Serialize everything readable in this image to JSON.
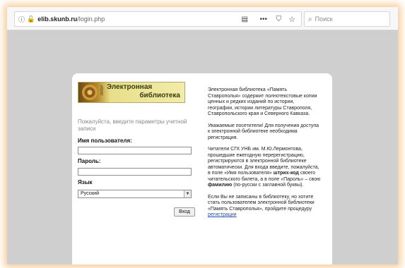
{
  "browser": {
    "url_host": "elib.skunb.ru",
    "url_path": "/login.php",
    "search_placeholder": "Поиск"
  },
  "logo": {
    "line1": "Электронная",
    "line2": "библиотека",
    "small": "ЛИБР"
  },
  "login": {
    "prompt": "Пожалуйста, введите параметры учетной записи",
    "username_label": "Имя пользователя:",
    "password_label": "Пароль:",
    "language_label": "Язык",
    "language_value": "Русский",
    "submit_label": "Вход"
  },
  "info": {
    "p1": "Электронная библиотека «Память Ставрополья» содержит полнотекстовые копии ценных и редких изданий по истории, географии, истории литературы Ставрополя, Ставропольского края и Северного Кавказа.",
    "p2": "Уважаемые посетители! Для получения доступа к электронной библиотеке необходима регистрация.",
    "p3_a": "Читатели СГК УНБ им. М.Ю.Лермонтова, прошедшие ежегодную перерегистрацию, регистрируются в электронной библиотеке автоматически. Для входа введите, пожалуйста, в поле «Имя пользователя»",
    "p3_b": "штрих-код",
    "p3_c": "своего читательского билета, а в поле «Пароль» – свою",
    "p3_d": "фамилию",
    "p3_e": "(по-русски с заглавной буквы).",
    "p4_a": "Если Вы не записаны в библиотеку, но хотите стать пользователем электронной библиотеки «Память Ставрополья», пройдите процедуру",
    "p4_link": "регистрации"
  }
}
